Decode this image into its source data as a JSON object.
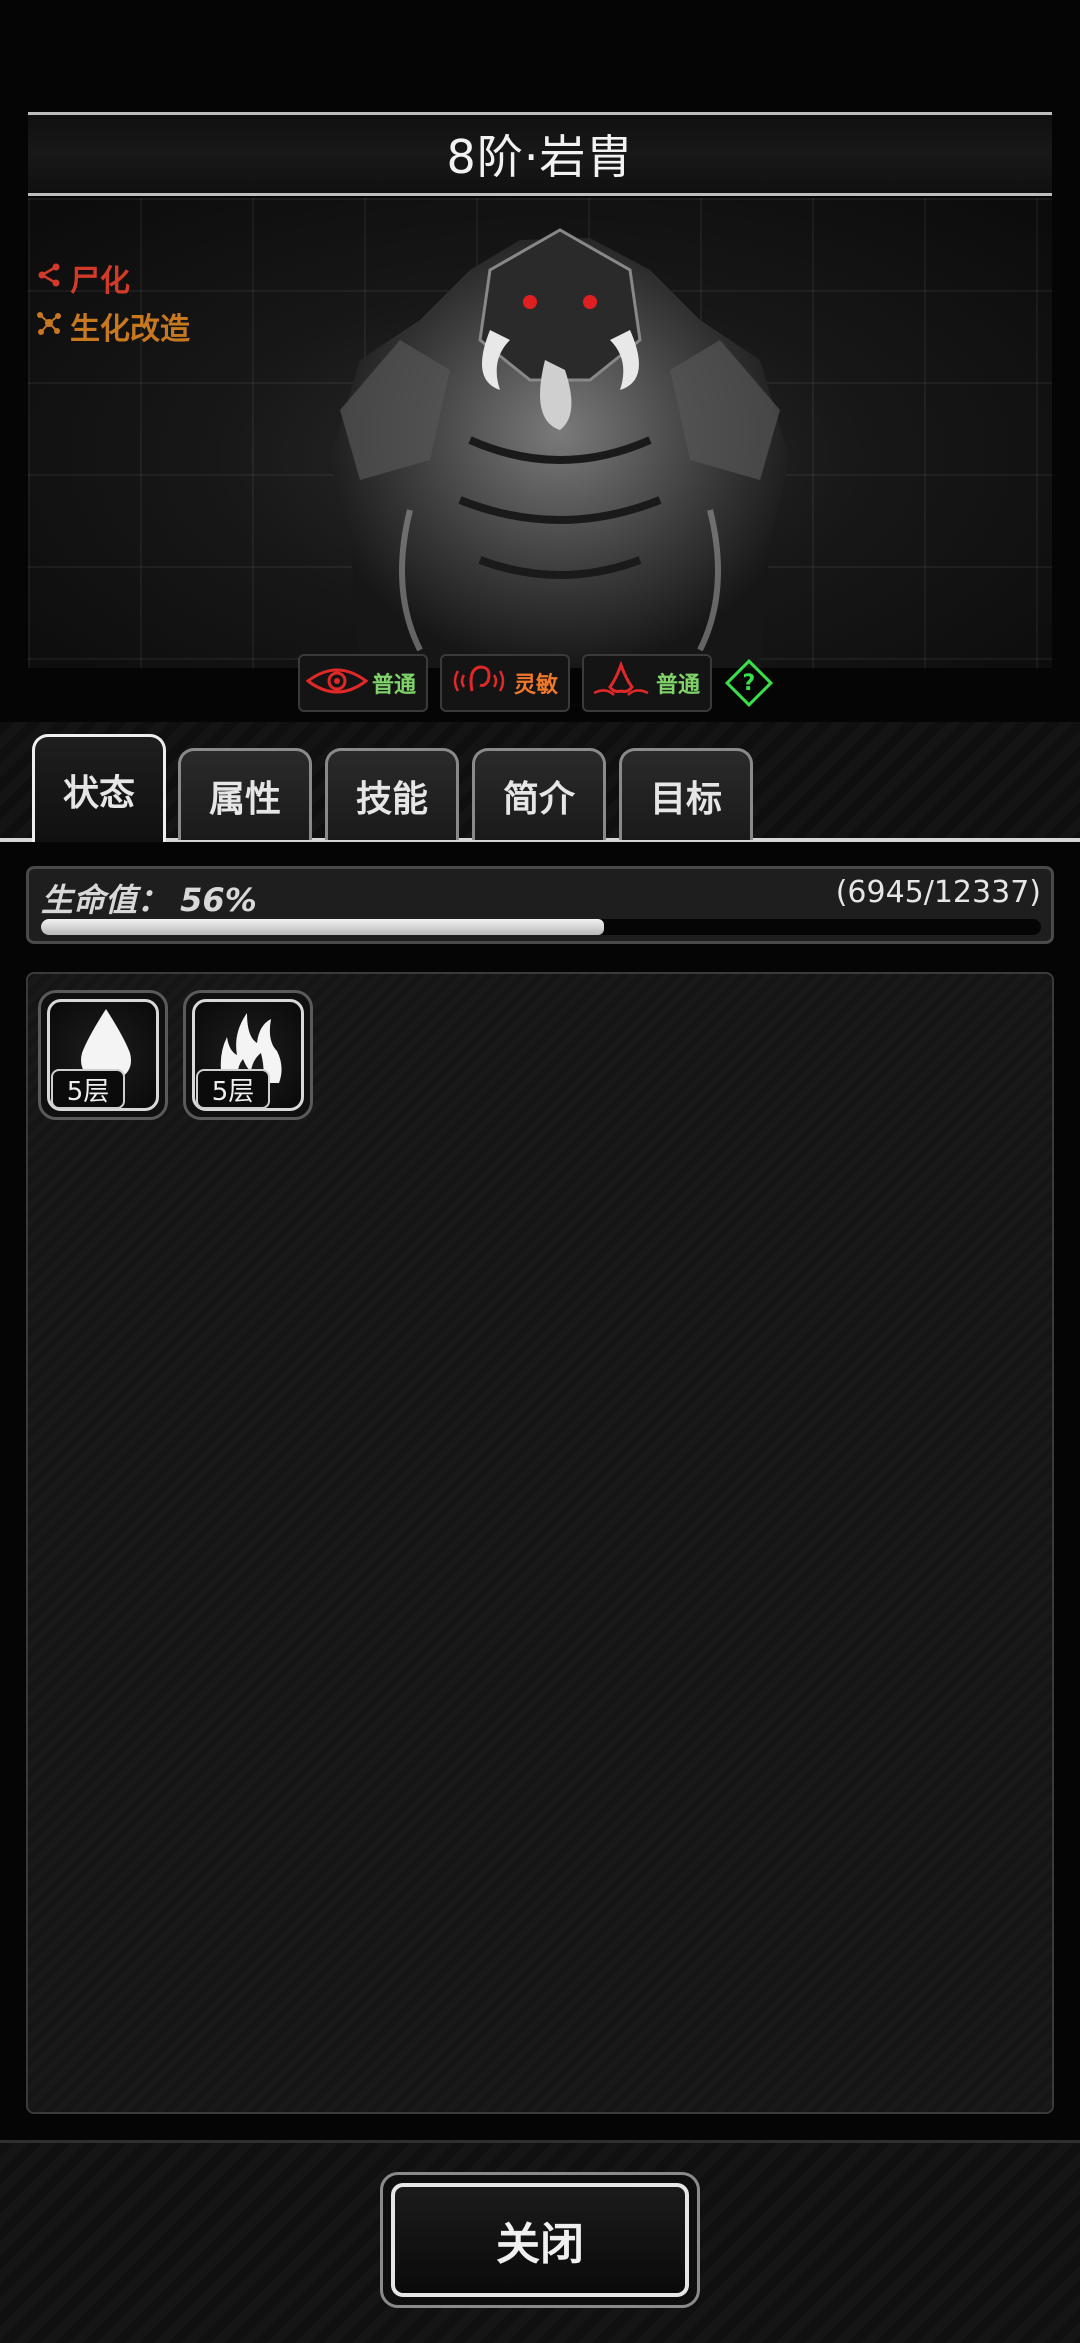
{
  "header": {
    "title": "8阶·岩胄"
  },
  "traits": [
    {
      "label": "尸化",
      "icon": "share-icon",
      "color": "#d23a2a"
    },
    {
      "label": "生化改造",
      "icon": "molecule-icon",
      "color": "#c8781e"
    }
  ],
  "senses": [
    {
      "icon": "eye-icon",
      "label": "普通",
      "color": "#7fd36a"
    },
    {
      "icon": "ear-icon",
      "label": "灵敏",
      "color": "#f0782a"
    },
    {
      "icon": "nose-icon",
      "label": "普通",
      "color": "#7fd36a"
    }
  ],
  "help": {
    "label": "?"
  },
  "tabs": [
    {
      "label": "状态",
      "active": true
    },
    {
      "label": "属性",
      "active": false
    },
    {
      "label": "技能",
      "active": false
    },
    {
      "label": "简介",
      "active": false
    },
    {
      "label": "目标",
      "active": false
    }
  ],
  "hp": {
    "label": "生命值：",
    "percent_text": "56%",
    "value_text": "(6945/12337)",
    "current": 6945,
    "max": 12337
  },
  "buffs": [
    {
      "icon": "droplet-icon",
      "stack": "5层"
    },
    {
      "icon": "fire-icon",
      "stack": "5层"
    }
  ],
  "footer": {
    "close_label": "关闭"
  }
}
